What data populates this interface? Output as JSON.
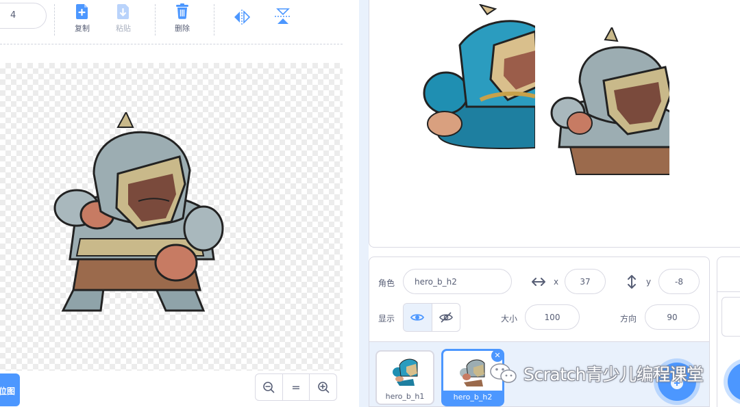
{
  "paint_editor": {
    "costume_name_value": "4",
    "toolbar": {
      "copy_label": "复制",
      "paste_label": "粘贴",
      "delete_label": "删除",
      "flip_horizontal_icon": "flip-horizontal-icon",
      "flip_vertical_icon": "flip-vertical-icon"
    },
    "convert_button_label": "位图",
    "zoom": {
      "zoom_out_icon": "zoom-out-icon",
      "reset_label": "=",
      "zoom_in_icon": "zoom-in-icon"
    }
  },
  "sprite_info": {
    "sprite_label": "角色",
    "sprite_name": "hero_b_h2",
    "x_label": "x",
    "x_value": "37",
    "y_label": "y",
    "y_value": "-8",
    "show_label": "显示",
    "size_label": "大小",
    "size_value": "100",
    "direction_label": "方向",
    "direction_value": "90"
  },
  "sprite_list": [
    {
      "name": "hero_b_h1",
      "selected": false
    },
    {
      "name": "hero_b_h2",
      "selected": true
    }
  ],
  "watermark_text": "Scratch青少儿编程课堂",
  "colors": {
    "accent": "#4c97ff",
    "panel_bg": "#e9f1fc",
    "text": "#575e75",
    "border": "#d9d9e3"
  }
}
